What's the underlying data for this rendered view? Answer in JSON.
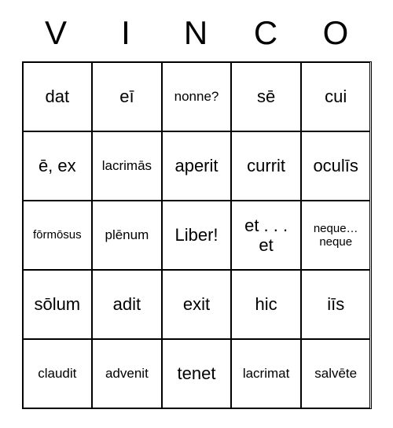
{
  "header": [
    "V",
    "I",
    "N",
    "C",
    "O"
  ],
  "cells": [
    {
      "text": "dat",
      "size": "normal"
    },
    {
      "text": "eī",
      "size": "normal"
    },
    {
      "text": "nonne?",
      "size": "small"
    },
    {
      "text": "sē",
      "size": "normal"
    },
    {
      "text": "cui",
      "size": "normal"
    },
    {
      "text": "ē, ex",
      "size": "normal"
    },
    {
      "text": "lacrimās",
      "size": "small"
    },
    {
      "text": "aperit",
      "size": "normal"
    },
    {
      "text": "currit",
      "size": "normal"
    },
    {
      "text": "oculīs",
      "size": "normal"
    },
    {
      "text": "fōrmōsus",
      "size": "xsmall"
    },
    {
      "text": "plēnum",
      "size": "small"
    },
    {
      "text": "Liber!",
      "size": "normal"
    },
    {
      "text": "et . . . et",
      "size": "normal"
    },
    {
      "text": "neque…neque",
      "size": "xsmall"
    },
    {
      "text": "sōlum",
      "size": "normal"
    },
    {
      "text": "adit",
      "size": "normal"
    },
    {
      "text": "exit",
      "size": "normal"
    },
    {
      "text": "hic",
      "size": "normal"
    },
    {
      "text": "iīs",
      "size": "normal"
    },
    {
      "text": "claudit",
      "size": "small"
    },
    {
      "text": "advenit",
      "size": "small"
    },
    {
      "text": "tenet",
      "size": "normal"
    },
    {
      "text": "lacrimat",
      "size": "small"
    },
    {
      "text": "salvēte",
      "size": "small"
    }
  ]
}
